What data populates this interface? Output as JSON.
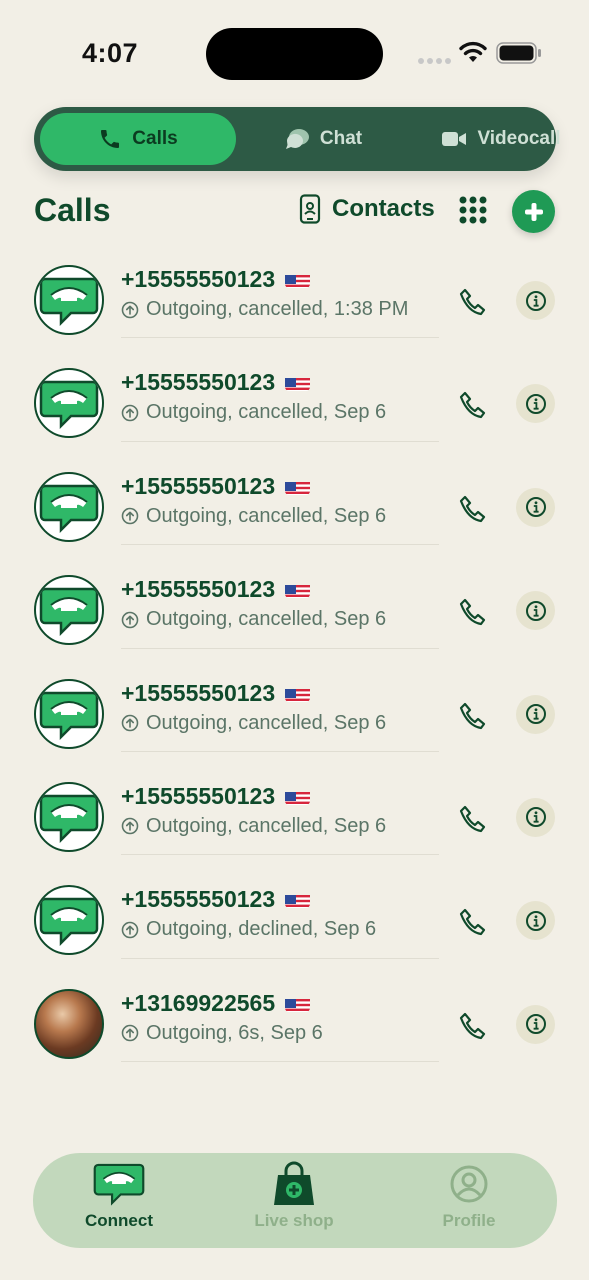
{
  "status_bar": {
    "time": "4:07"
  },
  "tabs": [
    {
      "label": "Calls",
      "icon": "phone-icon",
      "active": true
    },
    {
      "label": "Chat",
      "icon": "chat-bubble-icon",
      "active": false
    },
    {
      "label": "Videocall",
      "icon": "video-camera-icon",
      "active": false
    }
  ],
  "header": {
    "title": "Calls",
    "contacts_label": "Contacts",
    "grid_icon": "dialpad-grid-icon",
    "add_icon": "plus-icon"
  },
  "calls": [
    {
      "number": "+15555550123",
      "detail": "Outgoing, cancelled, 1:38 PM",
      "avatar": "app-logo"
    },
    {
      "number": "+15555550123",
      "detail": "Outgoing, cancelled, Sep 6",
      "avatar": "app-logo"
    },
    {
      "number": "+15555550123",
      "detail": "Outgoing, cancelled, Sep 6",
      "avatar": "app-logo"
    },
    {
      "number": "+15555550123",
      "detail": "Outgoing, cancelled, Sep 6",
      "avatar": "app-logo"
    },
    {
      "number": "+15555550123",
      "detail": "Outgoing, cancelled, Sep 6",
      "avatar": "app-logo"
    },
    {
      "number": "+15555550123",
      "detail": "Outgoing, cancelled, Sep 6",
      "avatar": "app-logo"
    },
    {
      "number": "+15555550123",
      "detail": "Outgoing, declined, Sep 6",
      "avatar": "app-logo"
    },
    {
      "number": "+13169922565",
      "detail": "Outgoing, 6s, Sep 6",
      "avatar": "photo"
    }
  ],
  "bottom_nav": [
    {
      "label": "Connect",
      "icon": "chat-phone-logo-icon",
      "active": true
    },
    {
      "label": "Live shop",
      "icon": "shopping-bag-icon",
      "active": false
    },
    {
      "label": "Profile",
      "icon": "person-circle-icon",
      "active": false
    }
  ],
  "colors": {
    "background": "#f2efe6",
    "primary_dark": "#0f4a2b",
    "accent_green": "#2fb868",
    "segment_bg": "#2d5a45",
    "nav_bg": "#c2d8bc"
  }
}
